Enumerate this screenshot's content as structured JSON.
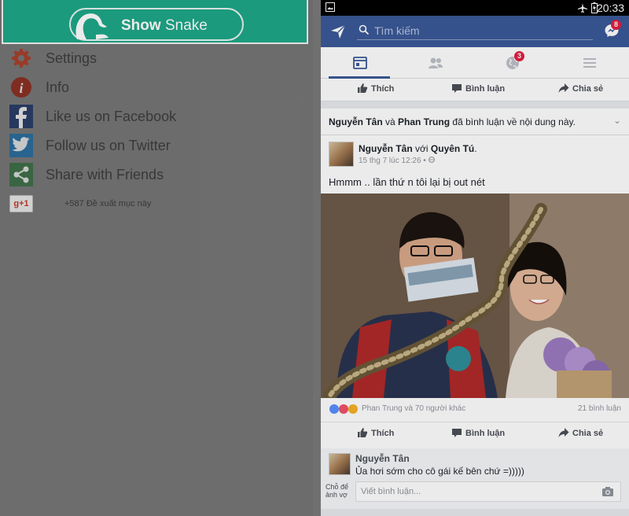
{
  "app": {
    "show_button": {
      "prefix": "Show",
      "suffix": "Snake"
    },
    "menu": [
      {
        "label": "Settings",
        "icon": "gear-icon"
      },
      {
        "label": "Info",
        "icon": "info-icon"
      },
      {
        "label": "Like us on Facebook",
        "icon": "facebook-icon"
      },
      {
        "label": "Follow us on Twitter",
        "icon": "twitter-icon"
      },
      {
        "label": "Share with Friends",
        "icon": "share-icon"
      }
    ],
    "gplus": {
      "badge": "g+1",
      "text": "+587 Đề xuất mục này"
    }
  },
  "phone": {
    "status": {
      "time": "20:33"
    },
    "search": {
      "placeholder": "Tìm kiếm"
    },
    "messenger_badge": "8",
    "notif_badge": "3",
    "actions": {
      "like": "Thích",
      "comment": "Bình luận",
      "share": "Chia sẻ"
    },
    "notification": {
      "a": "Nguyễn Tân",
      "and": "và",
      "b": "Phan Trung",
      "rest": "đã bình luận về nội dung này."
    },
    "post": {
      "author": "Nguyễn Tân",
      "with": "với",
      "tagged": "Quyên Tú",
      "time": "15 thg 7 lúc 12:26 •",
      "text": "Hmmm .. lần thứ n tôi lại bị out nét",
      "reactions": "Phan Trung và 70 người khác",
      "comments_count": "21 bình luận"
    },
    "comment": {
      "author": "Nguyễn Tân",
      "text": "Ủa hơi sớm cho cô gái kế bên chứ =)))))",
      "input_placeholder": "Viết bình luận...",
      "holder_label": "Chỗ để ảnh vợ"
    },
    "colors": {
      "fb_blue": "#3b5998",
      "teal": "#1ea888"
    }
  }
}
